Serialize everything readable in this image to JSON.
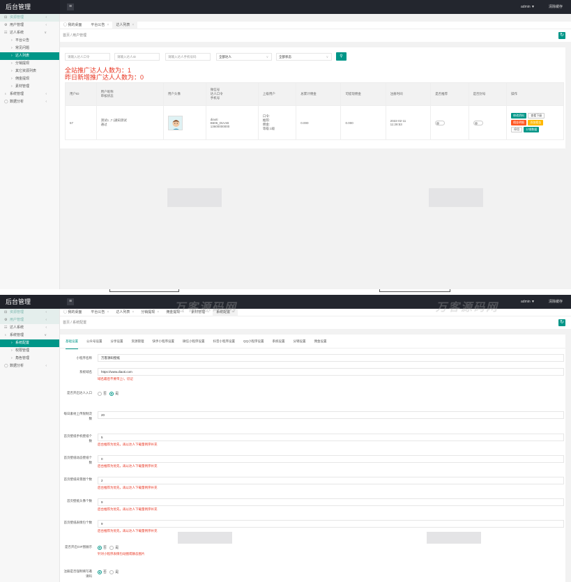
{
  "header": {
    "title": "后台管理",
    "menu_icon": "≡",
    "user": "admin ▼",
    "clear_cache": "清除缓存"
  },
  "panel1": {
    "sidebar": [
      {
        "icon": "⊟",
        "label": "资源管理",
        "arrow": "‹",
        "state": "dim"
      },
      {
        "icon": "⚙",
        "label": "用户管理",
        "arrow": "‹",
        "state": ""
      },
      {
        "icon": "☷",
        "label": "达人系统",
        "arrow": "∨",
        "state": ""
      },
      {
        "icon": "›",
        "label": "平台公告",
        "arrow": "",
        "state": "sub"
      },
      {
        "icon": "›",
        "label": "常见问题",
        "arrow": "",
        "state": "sub"
      },
      {
        "icon": "›",
        "label": "达人列表",
        "arrow": "",
        "state": "sub active"
      },
      {
        "icon": "›",
        "label": "分销提现",
        "arrow": "",
        "state": "sub"
      },
      {
        "icon": "›",
        "label": "其它资源列表",
        "arrow": "",
        "state": "sub"
      },
      {
        "icon": "›",
        "label": "佣金提现",
        "arrow": "",
        "state": "sub"
      },
      {
        "icon": "›",
        "label": "素材管理",
        "arrow": "",
        "state": "sub"
      },
      {
        "icon": "♁",
        "label": "系统管理",
        "arrow": "‹",
        "state": ""
      },
      {
        "icon": "◯",
        "label": "数据分析",
        "arrow": "‹",
        "state": ""
      }
    ],
    "tabs": [
      {
        "label": "◯ 我的桌面",
        "close": "",
        "active": false
      },
      {
        "label": "平台公告",
        "close": "×",
        "active": false
      },
      {
        "label": "达人列表",
        "close": "×",
        "active": true
      }
    ],
    "breadcrumb": "首页 / 用户管理",
    "refresh_icon": "↻",
    "filters": {
      "invite_code": "请输入达人口令",
      "talent_id": "请输入达人ID",
      "phone": "请输入达人手机号码",
      "talent_select": "全部达人",
      "status_select": "全部状态",
      "select_arrow": "∨",
      "search_icon": "⚲"
    },
    "stats": {
      "total": "全站推广达人人数为：1",
      "yesterday": "昨日新增推广达人人数为：0"
    },
    "table": {
      "headers": [
        "用户ID",
        "用户昵称\n审核状态",
        "用户头像",
        "微信号\n达人口令\n手机号",
        "上级用户",
        "总累计佣金",
        "可提现佣金",
        "注册时间",
        "是否推荐",
        "是否封号",
        "操作"
      ],
      "row": {
        "id": "57",
        "nickname": "测试1 ,7 (通知测试\n通过",
        "wechat": "diaoti\nB606_DIAAB\n13600000000",
        "parent": "口令:\n推荐:\n佣金:\n等级:1级",
        "total": "0.000",
        "withdrawable": "0.000",
        "reg_time": "2022-02-11\n11:28:53",
        "ops": [
          "修改资料",
          "查看下级",
          "佣金明细",
          "添加佣金",
          "停用",
          "分销数据"
        ]
      }
    }
  },
  "panel2": {
    "sidebar": [
      {
        "icon": "⊟",
        "label": "资源管理",
        "arrow": "‹",
        "state": "dim"
      },
      {
        "icon": "⚙",
        "label": "用户管理",
        "arrow": "‹",
        "state": "dim"
      },
      {
        "icon": "☷",
        "label": "达人系统",
        "arrow": "‹",
        "state": ""
      },
      {
        "icon": "♁",
        "label": "系统管理",
        "arrow": "∨",
        "state": ""
      },
      {
        "icon": "›",
        "label": "系统配置",
        "arrow": "",
        "state": "sub active"
      },
      {
        "icon": "›",
        "label": "权限管理",
        "arrow": "",
        "state": "sub"
      },
      {
        "icon": "›",
        "label": "角色管理",
        "arrow": "",
        "state": "sub"
      },
      {
        "icon": "◯",
        "label": "数据分析",
        "arrow": "‹",
        "state": ""
      }
    ],
    "tabs": [
      {
        "label": "◯ 我的桌面",
        "close": "",
        "active": false
      },
      {
        "label": "平台公告",
        "close": "×",
        "active": false
      },
      {
        "label": "达人列表",
        "close": "×",
        "active": false
      },
      {
        "label": "分销提现",
        "close": "×",
        "active": false
      },
      {
        "label": "佣金提现",
        "close": "×",
        "active": false
      },
      {
        "label": "素材管理",
        "close": "×",
        "active": false
      },
      {
        "label": "系统配置",
        "close": "×",
        "active": true
      }
    ],
    "breadcrumb": "首页 / 系统配置",
    "subtabs": [
      "基础设置",
      "公众号设置",
      "分享设置",
      "资源管理",
      "快手小程序设置",
      "微信小程序设置",
      "抖音小程序设置",
      "QQ小程序设置",
      "系统设置",
      "分销设置",
      "佣金设置"
    ],
    "form": {
      "miniapp_name": {
        "label": "小程序名称",
        "value": "万客源码壁纸"
      },
      "domain": {
        "label": "系统域名",
        "value": "https://www.diaoti.com",
        "hint": "域名最后不要带上/，切记"
      },
      "talent_entry": {
        "label": "是否开启达人入口",
        "opt_no": "否",
        "opt_yes": "是"
      },
      "daily_limit": {
        "label": "每日素材上传限制次数",
        "value": "20"
      },
      "home_phone": {
        "label": "首页壁纸手机壁纸个数",
        "value": "5",
        "hint": "后台推荐为优先，再以达人下载量例序补充"
      },
      "home_dynamic": {
        "label": "首页壁纸动态壁纸个数",
        "value": "0",
        "hint": "后台推荐为优先，再以达人下载量例序补充"
      },
      "home_bg": {
        "label": "首页壁纸背景图个数",
        "value": "2",
        "hint": "后台推荐为优先，再以达人下载量例序补充"
      },
      "home_avatar": {
        "label": "首页壁纸头像个数",
        "value": "9",
        "hint": "后台推荐为优先，再以达人下载量例序补充"
      },
      "home_emoji": {
        "label": "首页壁纸表情包个数",
        "value": "9",
        "hint": "后台推荐为优先，再以达人下载量例序补充"
      },
      "gif_show": {
        "label": "是否开启GIF图展示",
        "opt_no": "否",
        "opt_yes": "是",
        "hint": "针对小程序表情包动图或静态图片"
      },
      "register_phone": {
        "label": "注册是否强制填写邀请码",
        "opt_no": "否",
        "opt_yes": "是"
      }
    },
    "watermarks": [
      "万客源码网",
      "万客源码网"
    ]
  }
}
